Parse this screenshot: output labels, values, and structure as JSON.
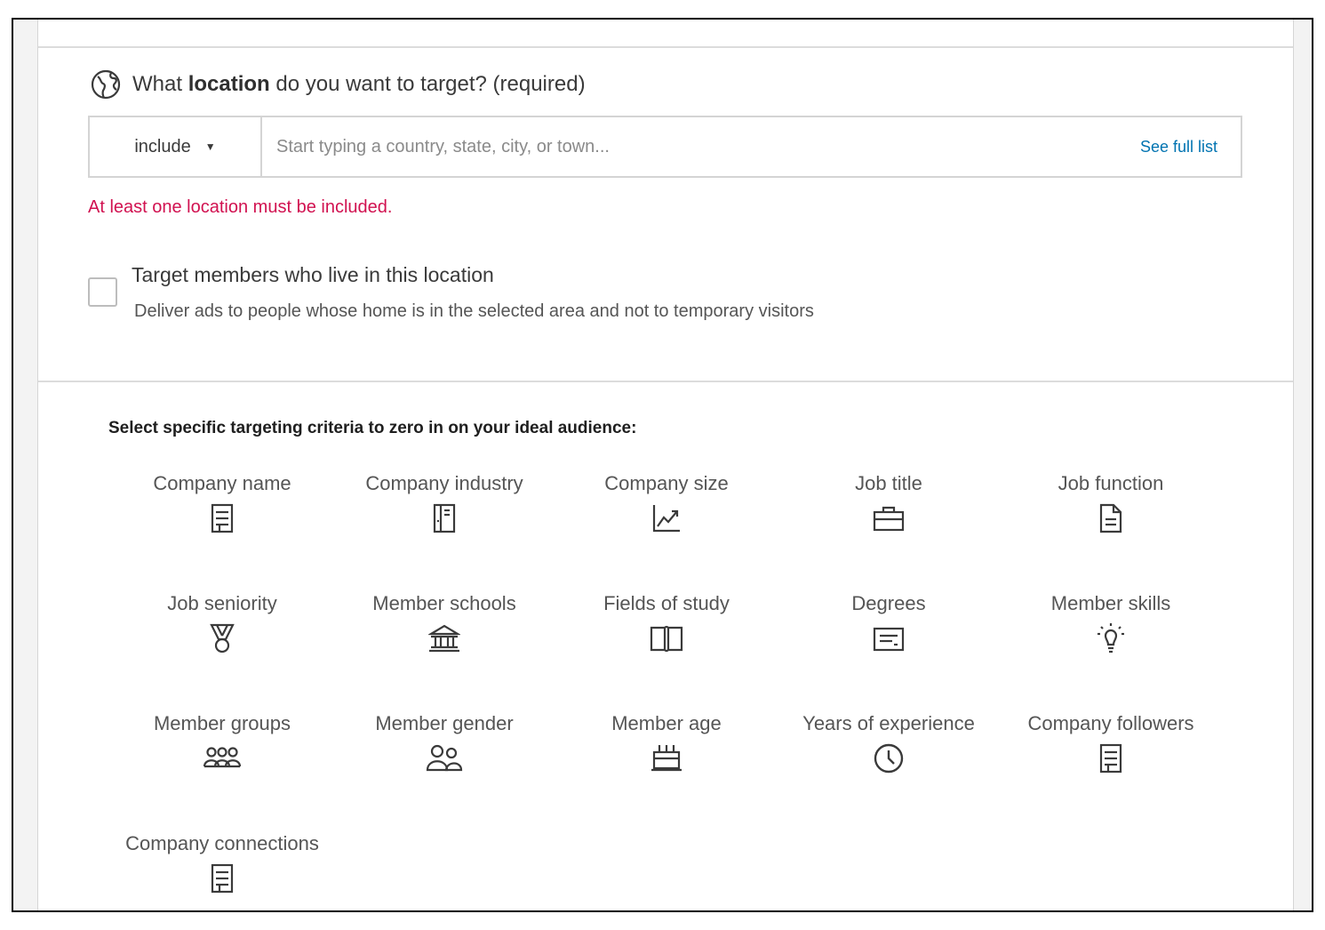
{
  "location": {
    "question_prefix": "What ",
    "question_bold": "location",
    "question_suffix": " do you want to target? (required)",
    "include_label": "include",
    "placeholder": "Start typing a country, state, city, or town...",
    "see_full_list": "See full list",
    "error": "At least one location must be included.",
    "checkbox_title": "Target members who live in this location",
    "checkbox_desc": "Deliver ads to people whose home is in the selected area and not to temporary visitors"
  },
  "criteria": {
    "title": "Select specific targeting criteria to zero in on your ideal audience:",
    "items": [
      {
        "label": "Company name",
        "icon": "building-icon"
      },
      {
        "label": "Company industry",
        "icon": "industry-icon"
      },
      {
        "label": "Company size",
        "icon": "chart-growth-icon"
      },
      {
        "label": "Job title",
        "icon": "briefcase-icon"
      },
      {
        "label": "Job function",
        "icon": "document-icon"
      },
      {
        "label": "Job seniority",
        "icon": "medal-icon"
      },
      {
        "label": "Member schools",
        "icon": "school-icon"
      },
      {
        "label": "Fields of study",
        "icon": "book-icon"
      },
      {
        "label": "Degrees",
        "icon": "certificate-icon"
      },
      {
        "label": "Member skills",
        "icon": "lightbulb-icon"
      },
      {
        "label": "Member groups",
        "icon": "group-icon"
      },
      {
        "label": "Member gender",
        "icon": "people-icon"
      },
      {
        "label": "Member age",
        "icon": "cake-icon"
      },
      {
        "label": "Years of experience",
        "icon": "clock-icon"
      },
      {
        "label": "Company followers",
        "icon": "building-icon"
      },
      {
        "label": "Company connections",
        "icon": "building-icon"
      }
    ]
  },
  "colors": {
    "error": "#d11150",
    "link": "#0073b1",
    "icon": "#3a3a3a"
  }
}
